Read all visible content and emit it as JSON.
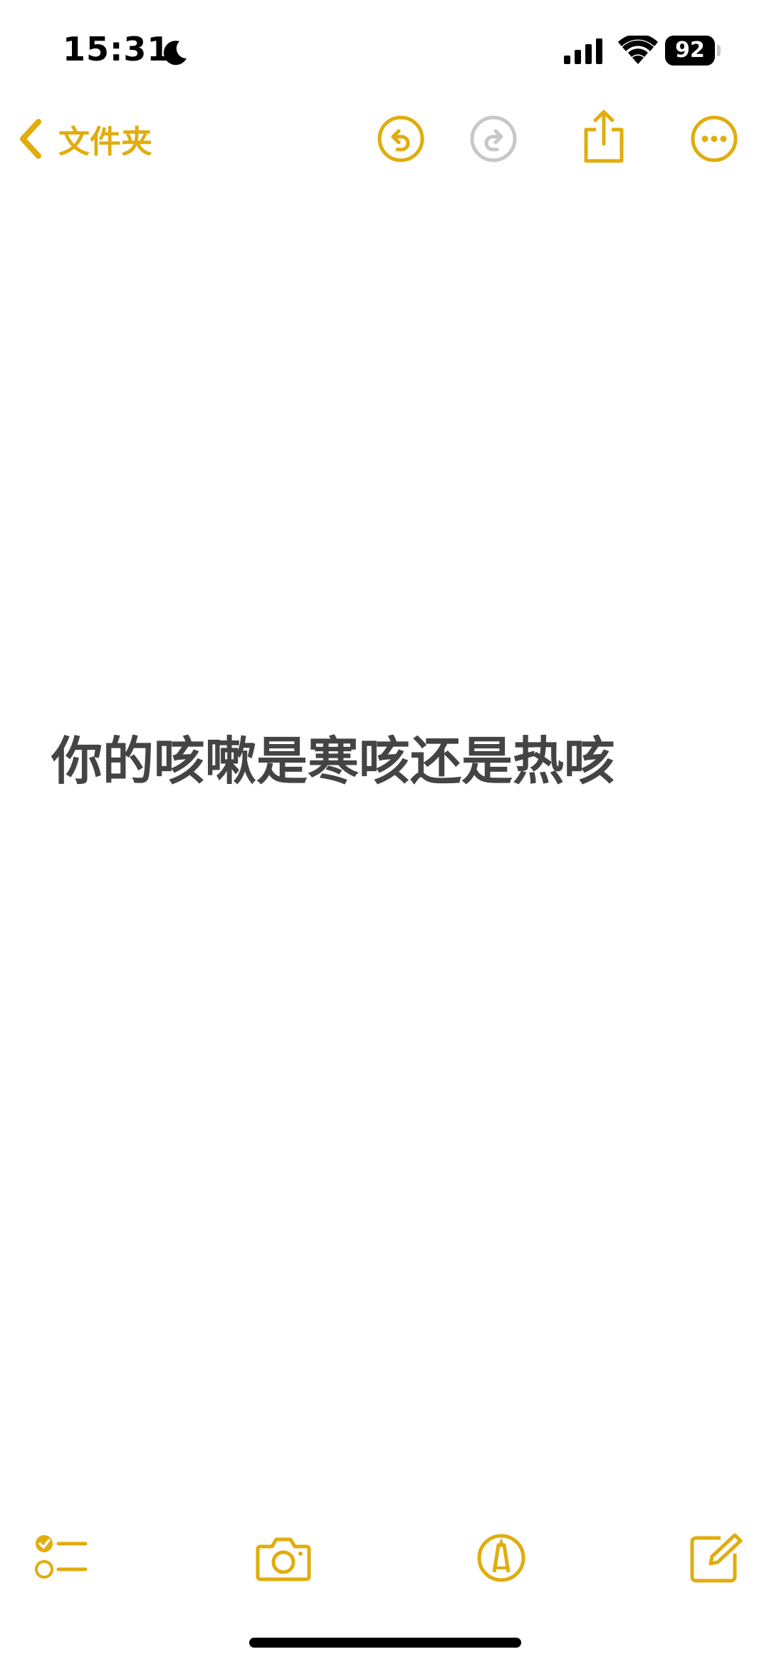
{
  "status_bar": {
    "time": "15:31",
    "battery_level": "92",
    "icons": [
      "moon-icon",
      "cellular-signal-icon",
      "wifi-icon",
      "battery-icon"
    ]
  },
  "nav": {
    "back_label": "文件夹",
    "icons": [
      "chevron-left-icon",
      "undo-icon",
      "redo-icon",
      "share-icon",
      "more-icon"
    ]
  },
  "note": {
    "body": "你的咳嗽是寒咳还是热咳"
  },
  "toolbar": {
    "icons": [
      "checklist-icon",
      "camera-icon",
      "markup-icon",
      "compose-icon"
    ]
  },
  "colors": {
    "accent": "#e1ac0d",
    "disabled": "#c7c7c7",
    "text": "#444444"
  }
}
